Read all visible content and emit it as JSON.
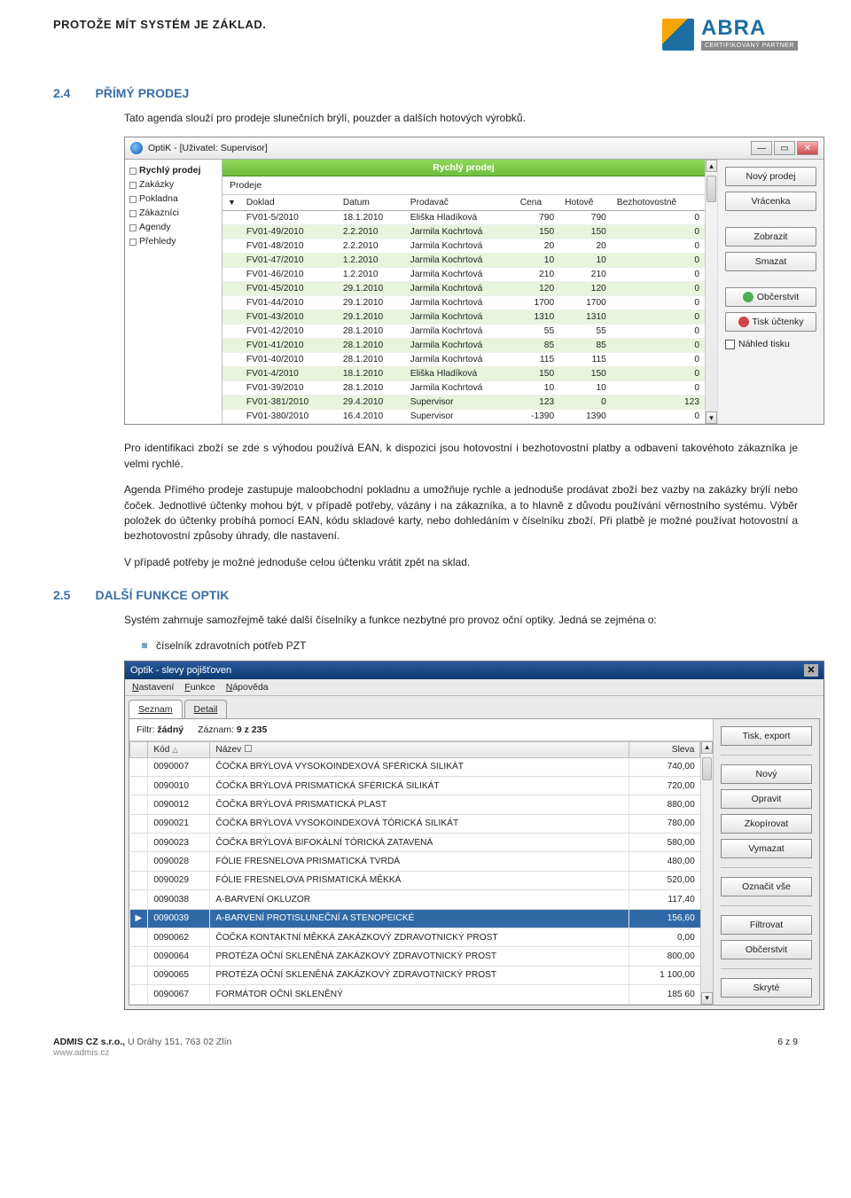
{
  "header": {
    "tagline": "PROTOŽE MÍT SYSTÉM JE ZÁKLAD.",
    "logo": "ABRA",
    "cert": "CERTIFIKOVANÝ PARTNER"
  },
  "section24": {
    "num": "2.4",
    "title": "PŘÍMÝ PRODEJ",
    "intro": "Tato agenda slouží pro prodeje slunečních brýlí, pouzder a dalších hotových výrobků.",
    "p1": "Pro identifikaci zboží se zde s výhodou používá EAN, k dispozici jsou hotovostní i bezhotovostní platby a odbavení takovéhoto zákazníka je velmi rychlé.",
    "p2": "Agenda Přímého prodeje zastupuje maloobchodní pokladnu a umožňuje rychle a jednoduše prodávat zboží bez vazby na zakázky brýlí nebo čoček. Jednotlivé účtenky mohou být, v případě potřeby, vázány i na zákazníka, a to hlavně z důvodu používání věrnostního systému. Výběr položek do účtenky probíhá pomocí EAN, kódu skladové karty, nebo dohledáním v číselníku zboží. Při platbě je možné používat hotovostní a bezhotovostní způsoby úhrady, dle nastavení.",
    "p3": "V případě potřeby je možné jednoduše celou účtenku vrátit zpět na sklad."
  },
  "section25": {
    "num": "2.5",
    "title": "DALŠÍ FUNKCE OPTIK",
    "p1": "Systém zahrnuje samozřejmě také další číselníky a funkce nezbytné pro provoz oční optiky. Jedná se zejména o:",
    "bullet1": "číselník zdravotních potřeb PZT"
  },
  "shot1": {
    "title": "OptiK - [Uživatel: Supervisor]",
    "nav": [
      "Rychlý prodej",
      "Zakázky",
      "Pokladna",
      "Zákazníci",
      "Agendy",
      "Přehledy"
    ],
    "panel_title": "Rychlý prodej",
    "tab": "Prodeje",
    "columns": [
      "Doklad",
      "Datum",
      "Prodavač",
      "Cena",
      "Hotově",
      "Bezhotovostně"
    ],
    "rows": [
      [
        "FV01-5/2010",
        "18.1.2010",
        "Eliška Hladíková",
        "790",
        "790",
        "0"
      ],
      [
        "FV01-49/2010",
        "2.2.2010",
        "Jarmila Kochrtová",
        "150",
        "150",
        "0"
      ],
      [
        "FV01-48/2010",
        "2.2.2010",
        "Jarmila Kochrtová",
        "20",
        "20",
        "0"
      ],
      [
        "FV01-47/2010",
        "1.2.2010",
        "Jarmila Kochrtová",
        "10",
        "10",
        "0"
      ],
      [
        "FV01-46/2010",
        "1.2.2010",
        "Jarmila Kochrtová",
        "210",
        "210",
        "0"
      ],
      [
        "FV01-45/2010",
        "29.1.2010",
        "Jarmila Kochrtová",
        "120",
        "120",
        "0"
      ],
      [
        "FV01-44/2010",
        "29.1.2010",
        "Jarmila Kochrtová",
        "1700",
        "1700",
        "0"
      ],
      [
        "FV01-43/2010",
        "29.1.2010",
        "Jarmila Kochrtová",
        "1310",
        "1310",
        "0"
      ],
      [
        "FV01-42/2010",
        "28.1.2010",
        "Jarmila Kochrtová",
        "55",
        "55",
        "0"
      ],
      [
        "FV01-41/2010",
        "28.1.2010",
        "Jarmila Kochrtová",
        "85",
        "85",
        "0"
      ],
      [
        "FV01-40/2010",
        "28.1.2010",
        "Jarmila Kochrtová",
        "115",
        "115",
        "0"
      ],
      [
        "FV01-4/2010",
        "18.1.2010",
        "Eliška Hladíková",
        "150",
        "150",
        "0"
      ],
      [
        "FV01-39/2010",
        "28.1.2010",
        "Jarmila Kochrtová",
        "10",
        "10",
        "0"
      ],
      [
        "FV01-381/2010",
        "29.4.2010",
        "Supervisor",
        "123",
        "0",
        "123"
      ],
      [
        "FV01-380/2010",
        "16.4.2010",
        "Supervisor",
        "-1390",
        "1390",
        "0"
      ]
    ],
    "buttons": [
      "Nový prodej",
      "Vrácenka",
      "Zobrazit",
      "Smazat",
      "Občerstvit",
      "Tisk účtenky"
    ],
    "checkbox": "Náhled tisku"
  },
  "shot2": {
    "title": "Optik - slevy pojišťoven",
    "menu": [
      "Nastavení",
      "Funkce",
      "Nápověda"
    ],
    "tabs": [
      "Seznam",
      "Detail"
    ],
    "filter_label": "Filtr:",
    "filter_value": "žádný",
    "record_label": "Záznam:",
    "record_value": "9 z 235",
    "columns": [
      "Kód",
      "Název",
      "Sleva"
    ],
    "rows": [
      [
        "0090007",
        "ČOČKA BRÝLOVÁ VYSOKOINDEXOVÁ SFÉRICKÁ    SILIKÁT",
        "740,00"
      ],
      [
        "0090010",
        "ČOČKA BRÝLOVÁ PRISMATICKÁ  SFÉRICKÁ    SILIKÁT",
        "720,00"
      ],
      [
        "0090012",
        "ČOČKA BRÝLOVÁ PRISMATICKÁ              PLAST",
        "880,00"
      ],
      [
        "0090021",
        "ČOČKA BRÝLOVÁ VYSOKOINDEXOVÁ TÓRICKÁ    SILIKÁT",
        "780,00"
      ],
      [
        "0090023",
        "ČOČKA BRÝLOVÁ BIFOKÁLNÍ TÓRICKÁ  ZATAVENÁ",
        "580,00"
      ],
      [
        "0090028",
        "FÓLIE FRESNELOVA PRISMATICKÁ TVRDÁ",
        "480,00"
      ],
      [
        "0090029",
        "FÓLIE FRESNELOVA PRISMATICKÁ MĚKKÁ",
        "520,00"
      ],
      [
        "0090038",
        "A-BARVENÍ OKLUZOR",
        "117,40"
      ],
      [
        "0090039",
        "A-BARVENÍ PROTISLUNEČNÍ A STENOPEICKÉ",
        "156,60"
      ],
      [
        "0090062",
        "ČOČKA KONTAKTNÍ MĚKKÁ ZAKÁZKOVÝ ZDRAVOTNICKÝ PROST",
        "0,00"
      ],
      [
        "0090064",
        "PROTÉZA OČNÍ SKLENĚNÁ ZAKÁZKOVÝ ZDRAVOTNICKÝ PROST",
        "800,00"
      ],
      [
        "0090065",
        "PROTÉZA OČNÍ SKLENĚNÁ ZAKÁZKOVÝ ZDRAVOTNICKÝ PROST",
        "1 100,00"
      ],
      [
        "0090067",
        "FORMÁTOR OČNÍ SKLENĚNÝ",
        "185 60"
      ]
    ],
    "selected_index": 8,
    "buttons": [
      "Tisk, export",
      "Nový",
      "Opravit",
      "Zkopírovat",
      "Vymazat",
      "Označit vše",
      "Filtrovat",
      "Občerstvit",
      "Skryté"
    ]
  },
  "footer": {
    "company": "ADMIS CZ s.r.o.,",
    "addr": "U Dráhy 151, 763 02 Zlín",
    "url": "www.admis.cz",
    "page": "6 z 9"
  }
}
